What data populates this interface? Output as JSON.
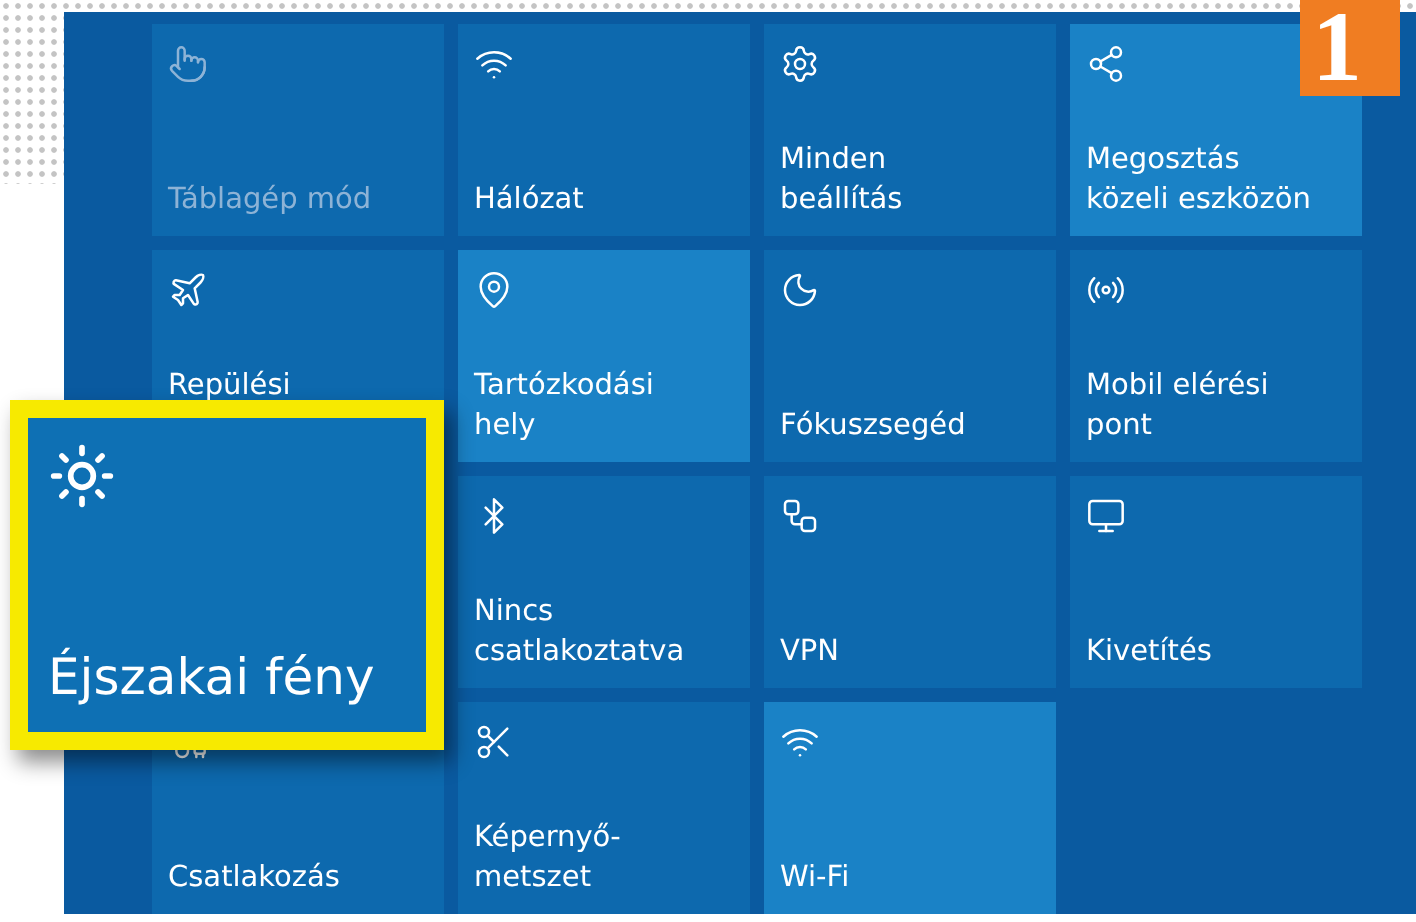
{
  "tiles": [
    {
      "label": "Táblagép mód",
      "on": false,
      "disabled": true
    },
    {
      "label": "Hálózat",
      "on": false,
      "disabled": false
    },
    {
      "label": "Minden\nbeállítás",
      "on": false,
      "disabled": false
    },
    {
      "label": "Megosztás\nközeli eszközön",
      "on": true,
      "disabled": false
    },
    {
      "label": "Repülési",
      "on": false,
      "disabled": false
    },
    {
      "label": "Tartózkodási\nhely",
      "on": true,
      "disabled": false
    },
    {
      "label": "Fókuszsegéd",
      "on": false,
      "disabled": false
    },
    {
      "label": "Mobil elérési\npont",
      "on": false,
      "disabled": false
    },
    {
      "label": "Nincs\ncsatlakoztatva",
      "on": false,
      "disabled": false
    },
    {
      "label": "VPN",
      "on": false,
      "disabled": false
    },
    {
      "label": "Kivetítés",
      "on": false,
      "disabled": false
    },
    {
      "label": "Csatlakozás",
      "on": false,
      "disabled": false
    },
    {
      "label": "Képernyő-\nmetszet",
      "on": false,
      "disabled": false
    },
    {
      "label": "Wi-Fi",
      "on": true,
      "disabled": false
    }
  ],
  "callout": {
    "label": "Éjszakai fény"
  },
  "badge": "1"
}
